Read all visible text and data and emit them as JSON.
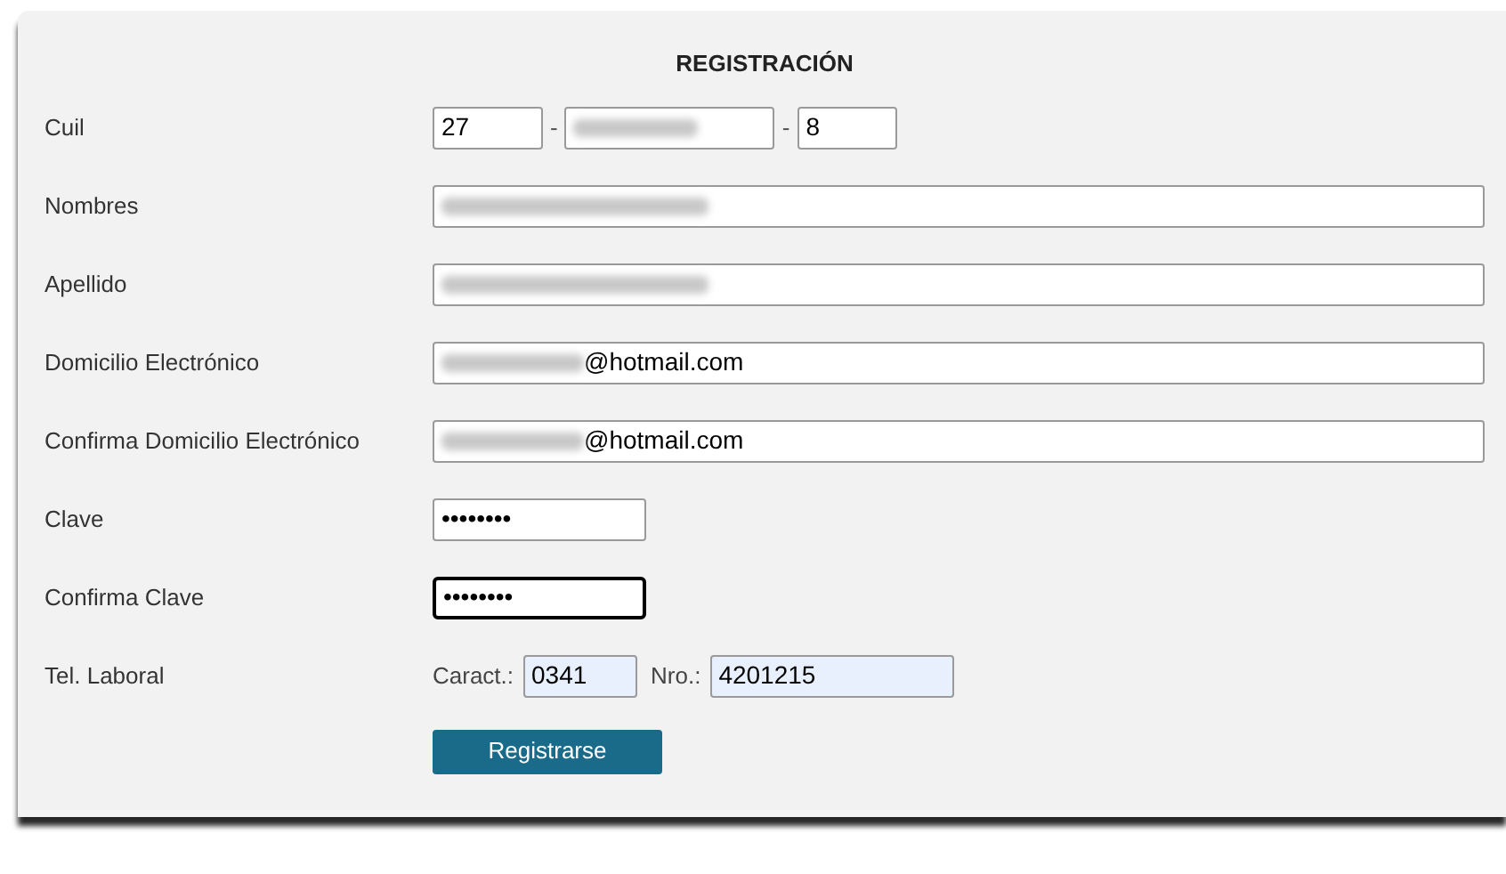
{
  "form": {
    "title": "REGISTRACIÓN",
    "rows": [
      {
        "kind": "cuil",
        "label": "Cuil",
        "parts": [
          {
            "value": "27",
            "redacted": false
          },
          {
            "redacted": true
          },
          {
            "value": "8",
            "redacted": false
          }
        ],
        "separator": "-"
      },
      {
        "kind": "text",
        "label": "Nombres",
        "redacted": true,
        "focused": false
      },
      {
        "kind": "text",
        "label": "Apellido",
        "redacted": true,
        "focused": false
      },
      {
        "kind": "text",
        "label": "Domicilio Electrónico",
        "value": "@hotmail.com",
        "redacted": true,
        "focused": false
      },
      {
        "kind": "text",
        "label": "Confirma Domicilio Electrónico",
        "value": "@hotmail.com",
        "redacted": true,
        "focused": false
      },
      {
        "kind": "password",
        "label": "Clave",
        "value": "••••••••",
        "focused": false
      },
      {
        "kind": "password",
        "label": "Confirma Clave",
        "value": "••••••••",
        "focused": true
      },
      {
        "kind": "phone",
        "label": "Tel. Laboral",
        "fields": [
          {
            "label": "Caract.:",
            "value": "0341",
            "autofilled": true
          },
          {
            "label": "Nro.:",
            "value": "4201215",
            "autofilled": true
          }
        ]
      }
    ],
    "submit": "Registrarse"
  }
}
